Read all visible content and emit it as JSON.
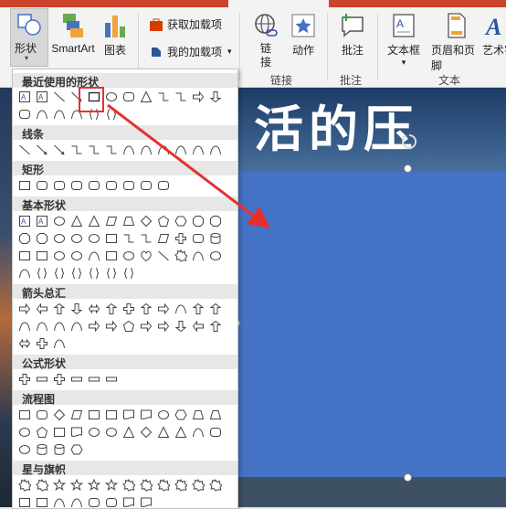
{
  "ribbon": {
    "shapes_label": "形状",
    "smartart_label": "SmartArt",
    "chart_label": "图表",
    "get_addins_label": "获取加载项",
    "my_addins_label": "我的加载项",
    "link_label": "链\n接",
    "action_label": "动作",
    "comment_label": "批注",
    "textbox_label": "文本框",
    "header_footer_label": "页眉和页脚",
    "wordart_label": "艺术字",
    "groups": {
      "links": "链接",
      "comments": "批注",
      "text": "文本"
    }
  },
  "gallery": {
    "sections": [
      "最近使用的形状",
      "线条",
      "矩形",
      "基本形状",
      "箭头总汇",
      "公式形状",
      "流程图",
      "星与旗帜"
    ]
  },
  "slide": {
    "title_text": "活的压"
  },
  "colors": {
    "accent": "#4472c4",
    "highlight": "#e53030",
    "ribbon_bg": "#f3f3f3"
  }
}
